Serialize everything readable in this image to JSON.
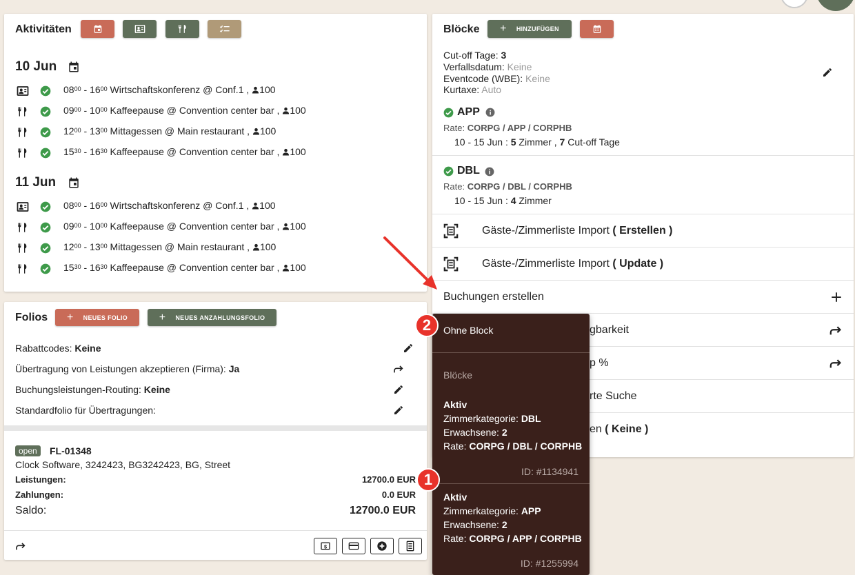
{
  "activities": {
    "title": "Aktivitäten",
    "days": [
      {
        "date": "10 Jun",
        "items": [
          {
            "type": "conference",
            "start_h": "08",
            "start_m": "00",
            "end_h": "16",
            "end_m": "00",
            "text": "Wirtschaftskonferenz @ Conf.1 ,",
            "count": "100"
          },
          {
            "type": "food",
            "start_h": "09",
            "start_m": "00",
            "end_h": "10",
            "end_m": "00",
            "text": "Kaffeepause @ Convention center bar ,",
            "count": "100"
          },
          {
            "type": "food",
            "start_h": "12",
            "start_m": "00",
            "end_h": "13",
            "end_m": "00",
            "text": "Mittagessen @ Main restaurant ,",
            "count": "100"
          },
          {
            "type": "food",
            "start_h": "15",
            "start_m": "30",
            "end_h": "16",
            "end_m": "30",
            "text": "Kaffeepause @ Convention center bar ,",
            "count": "100"
          }
        ]
      },
      {
        "date": "11 Jun",
        "items": [
          {
            "type": "conference",
            "start_h": "08",
            "start_m": "00",
            "end_h": "16",
            "end_m": "00",
            "text": "Wirtschaftskonferenz @ Conf.1 ,",
            "count": "100"
          },
          {
            "type": "food",
            "start_h": "09",
            "start_m": "00",
            "end_h": "10",
            "end_m": "00",
            "text": "Kaffeepause @ Convention center bar ,",
            "count": "100"
          },
          {
            "type": "food",
            "start_h": "12",
            "start_m": "00",
            "end_h": "13",
            "end_m": "00",
            "text": "Mittagessen @ Main restaurant ,",
            "count": "100"
          },
          {
            "type": "food",
            "start_h": "15",
            "start_m": "30",
            "end_h": "16",
            "end_m": "30",
            "text": "Kaffeepause @ Convention center bar ,",
            "count": "100"
          }
        ]
      }
    ]
  },
  "folios": {
    "title": "Folios",
    "new_folio": "NEUES FOLIO",
    "new_deposit_folio": "NEUES ANZAHLUNGSFOLIO",
    "settings": [
      {
        "label": "Rabattcodes: ",
        "value": "Keine",
        "action": "edit"
      },
      {
        "label": "Übertragung von Leistungen akzeptieren (Firma): ",
        "value": "Ja",
        "action": "forward"
      },
      {
        "label": "Buchungsleistungen-Routing: ",
        "value": "Keine",
        "action": "edit"
      },
      {
        "label": "Standardfolio für Übertragungen:",
        "value": "",
        "action": "edit"
      }
    ],
    "folio": {
      "status": "open",
      "number": "FL-01348",
      "company": "Clock Software, 3242423, BG3242423, BG, Street",
      "services_label": "Leistungen:",
      "services_value": "12700.0 EUR",
      "payments_label": "Zahlungen:",
      "payments_value": "0.0 EUR",
      "balance_label": "Saldo:",
      "balance_value": "12700.0 EUR"
    }
  },
  "blocks": {
    "title": "Blöcke",
    "add_label": "HINZUFÜGEN",
    "cutoff_label": "Cut-off Tage: ",
    "cutoff_value": "3",
    "expiry_label": "Verfallsdatum: ",
    "expiry_value": "Keine",
    "eventcode_label": "Eventcode (WBE): ",
    "eventcode_value": "Keine",
    "tax_label": "Kurtaxe: ",
    "tax_value": "Auto",
    "items": [
      {
        "name": "APP",
        "rate_label": "Rate: ",
        "rate": "CORPG / APP / CORPHB",
        "range": "10 - 15 Jun : ",
        "rooms": "5",
        "rooms_label": " Zimmer , ",
        "cutoff": "7",
        "cutoff_label": " Cut-off Tage"
      },
      {
        "name": "DBL",
        "rate_label": "Rate: ",
        "rate": "CORPG / DBL / CORPHB",
        "range": "10 - 15 Jun : ",
        "rooms": "4",
        "rooms_label": " Zimmer",
        "cutoff": "",
        "cutoff_label": ""
      }
    ],
    "menu": [
      {
        "label": "Gäste-/Zimmerliste Import ",
        "bold": "( Erstellen )"
      },
      {
        "label": "Gäste-/Zimmerliste Import ",
        "bold": "( Update )"
      },
      {
        "label": "Buchungen erstellen",
        "bold": ""
      },
      {
        "label": "gbarkeit",
        "bold": ""
      },
      {
        "label": "p %",
        "bold": ""
      },
      {
        "label": "rte Suche",
        "bold": ""
      },
      {
        "label": "en ",
        "bold": "( Keine )"
      }
    ]
  },
  "dropdown": {
    "no_block": "Ohne Block",
    "section": "Blöcke",
    "entries": [
      {
        "status": "Aktiv",
        "cat_label": "Zimmerkategorie: ",
        "cat": "DBL",
        "adults_label": "Erwachsene: ",
        "adults": "2",
        "rate_label": "Rate: ",
        "rate": "CORPG / DBL / CORPHB",
        "id": "ID: #1134941"
      },
      {
        "status": "Aktiv",
        "cat_label": "Zimmerkategorie: ",
        "cat": "APP",
        "adults_label": "Erwachsene: ",
        "adults": "2",
        "rate_label": "Rate: ",
        "rate": "CORPG / APP / CORPHB",
        "id": "ID: #1255994"
      }
    ]
  },
  "annotations": {
    "badge1": "1",
    "badge2": "2",
    "arrow_color": "#e8322a"
  },
  "colors": {
    "red": "#c96b58",
    "green": "#5f6f5a",
    "tan": "#b09a78",
    "dark": "#3a201b",
    "check": "#3e9a4a"
  }
}
